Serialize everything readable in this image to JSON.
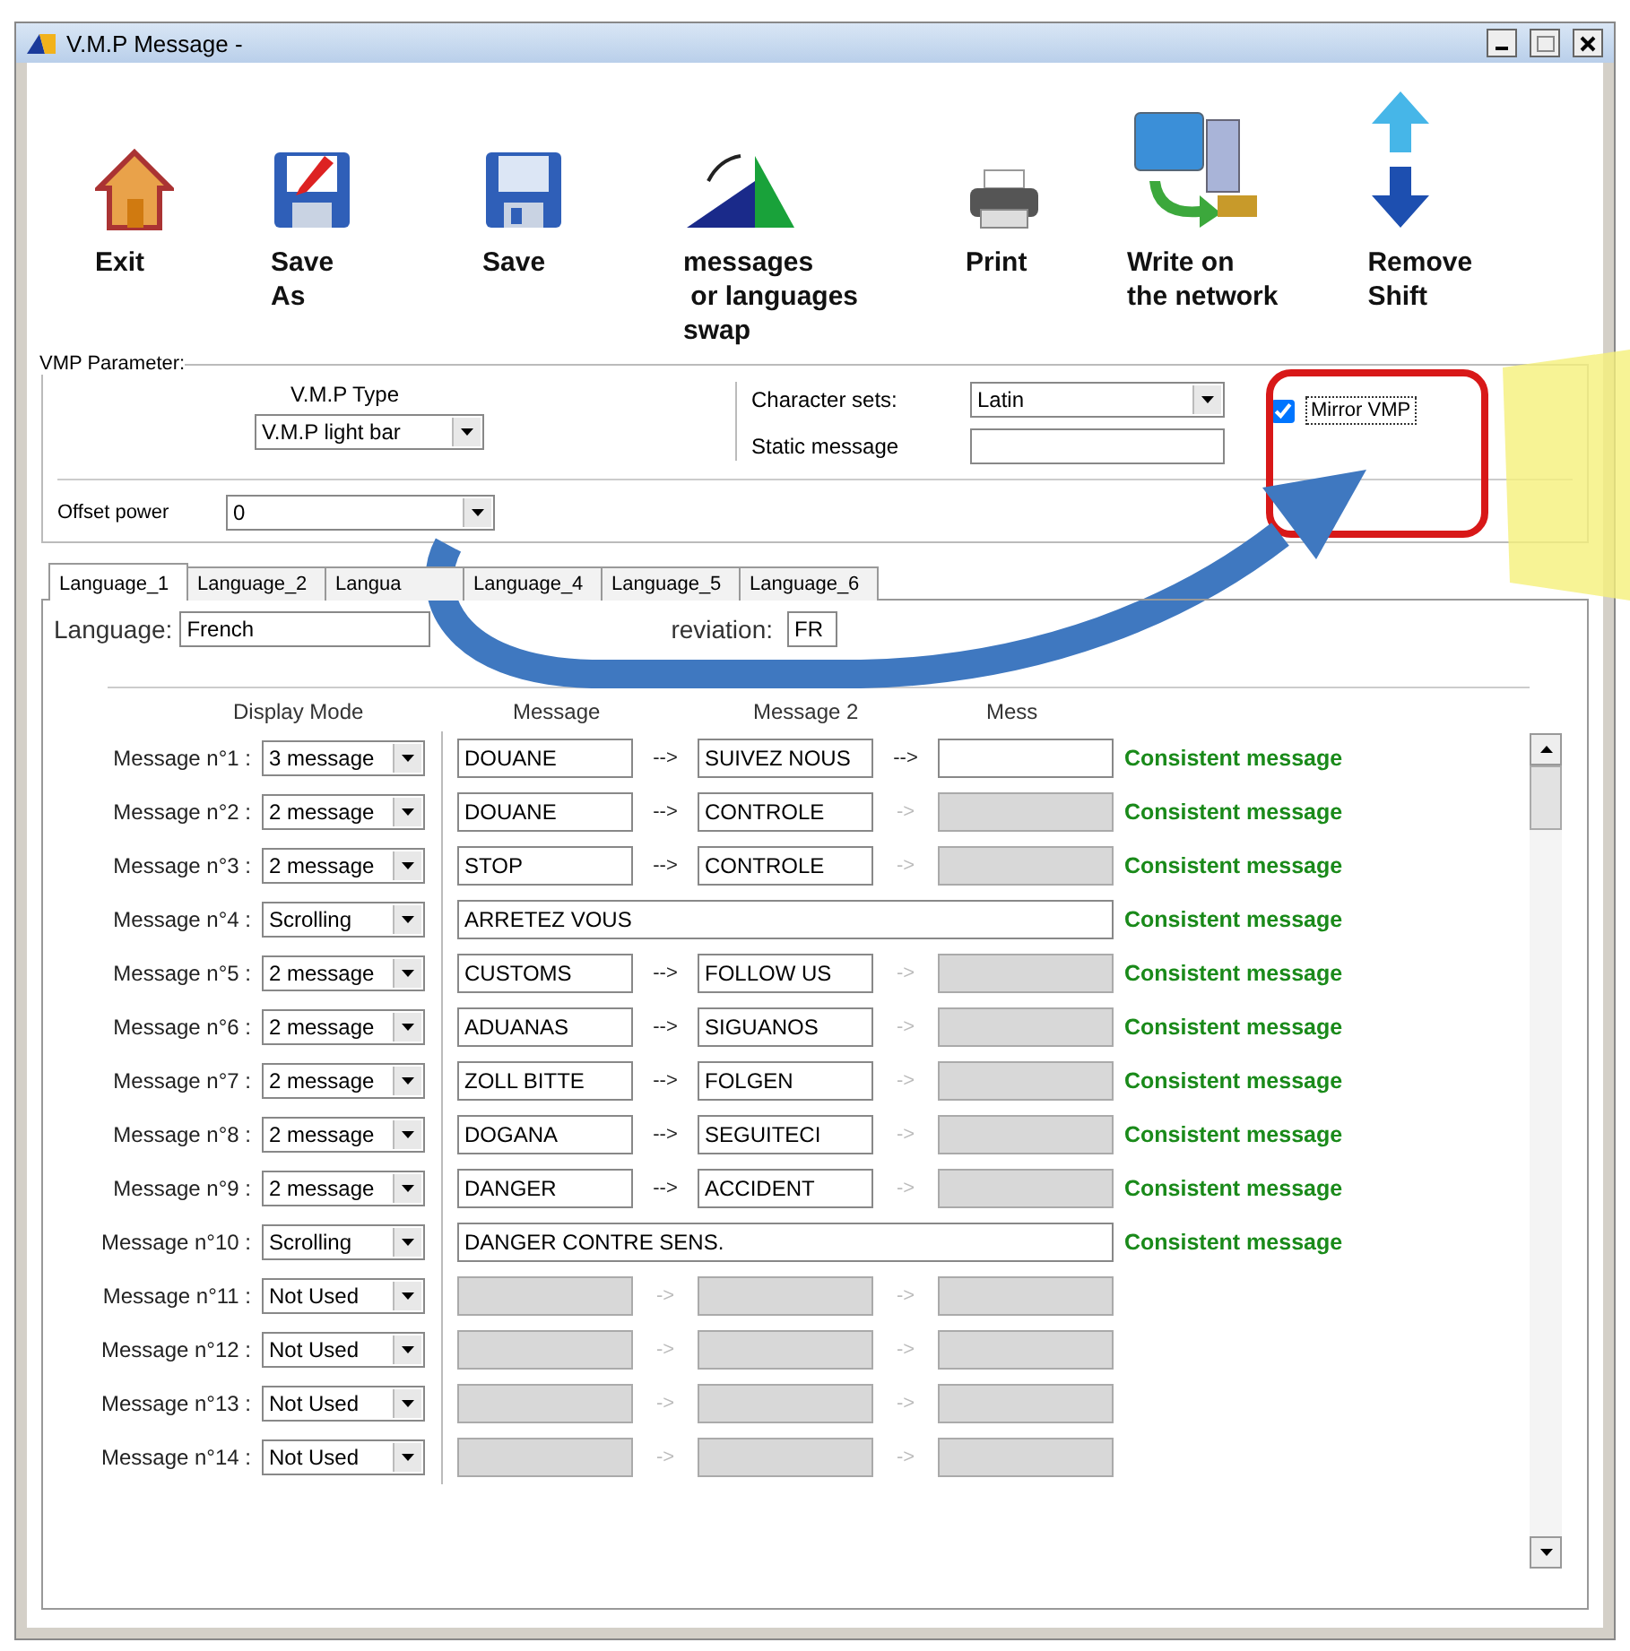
{
  "window": {
    "title": "V.M.P Message -"
  },
  "toolbar": [
    {
      "kind": "home",
      "label": "Exit"
    },
    {
      "kind": "saveas",
      "label": "Save\nAs"
    },
    {
      "kind": "save",
      "label": "Save"
    },
    {
      "kind": "swap",
      "label": "messages\n or languages\nswap"
    },
    {
      "kind": "print",
      "label": "Print"
    },
    {
      "kind": "network",
      "label": "Write on\nthe network"
    },
    {
      "kind": "shift",
      "label": "Remove\nShift"
    }
  ],
  "params": {
    "legend": "VMP Parameter:",
    "type_label": "V.M.P Type",
    "type_value": "V.M.P light bar",
    "charset_label": "Character sets:",
    "charset_value": "Latin",
    "static_label": "Static message",
    "mirror": {
      "label": "Mirror VMP",
      "checked": true
    },
    "offset_label": "Offset power",
    "offset_value": "0"
  },
  "tabs": [
    {
      "label": "Language_1",
      "selected": true
    },
    {
      "label": "Language_2",
      "selected": false
    },
    {
      "label": "Langua",
      "selected": false
    },
    {
      "label": "Language_4",
      "selected": false
    },
    {
      "label": "Language_5",
      "selected": false
    },
    {
      "label": "Language_6",
      "selected": false
    }
  ],
  "language": {
    "label": "Language:",
    "value": "French",
    "abbr_label": "reviation:",
    "abbr_value": "FR"
  },
  "headers": [
    "Display Mode",
    "Message",
    "Message 2",
    "Mess"
  ],
  "rows": [
    {
      "label": "Message n°1 :",
      "mode": "3 message",
      "kind": "split",
      "fields": [
        {
          "value": "DOUANE",
          "disabled": false
        },
        {
          "value": "SUIVEZ NOUS",
          "disabled": false
        },
        {
          "disabled": false
        }
      ],
      "arrows": [
        {
          "text": "-->",
          "disabled": false
        },
        {
          "text": "-->",
          "disabled": false
        }
      ],
      "status": "Consistent message"
    },
    {
      "label": "Message n°2 :",
      "mode": "2 message",
      "kind": "split",
      "fields": [
        {
          "value": "DOUANE",
          "disabled": false
        },
        {
          "value": "CONTROLE",
          "disabled": false
        },
        {
          "disabled": true
        }
      ],
      "arrows": [
        {
          "text": "-->",
          "disabled": false
        },
        {
          "text": "->",
          "disabled": true
        }
      ],
      "status": "Consistent message"
    },
    {
      "label": "Message n°3 :",
      "mode": "2 message",
      "kind": "split",
      "fields": [
        {
          "value": "STOP",
          "disabled": false
        },
        {
          "value": "CONTROLE",
          "disabled": false
        },
        {
          "disabled": true
        }
      ],
      "arrows": [
        {
          "text": "-->",
          "disabled": false
        },
        {
          "text": "->",
          "disabled": true
        }
      ],
      "status": "Consistent message"
    },
    {
      "label": "Message n°4 :",
      "mode": "Scrolling",
      "kind": "scrolling",
      "fields": [
        {
          "value": "ARRETEZ VOUS",
          "disabled": false
        }
      ],
      "arrows": [],
      "status": "Consistent message"
    },
    {
      "label": "Message n°5 :",
      "mode": "2 message",
      "kind": "split",
      "fields": [
        {
          "value": "CUSTOMS",
          "disabled": false
        },
        {
          "value": "FOLLOW US",
          "disabled": false
        },
        {
          "disabled": true
        }
      ],
      "arrows": [
        {
          "text": "-->",
          "disabled": false
        },
        {
          "text": "->",
          "disabled": true
        }
      ],
      "status": "Consistent message"
    },
    {
      "label": "Message n°6 :",
      "mode": "2 message",
      "kind": "split",
      "fields": [
        {
          "value": "ADUANAS",
          "disabled": false
        },
        {
          "value": "SIGUANOS",
          "disabled": false
        },
        {
          "disabled": true
        }
      ],
      "arrows": [
        {
          "text": "-->",
          "disabled": false
        },
        {
          "text": "->",
          "disabled": true
        }
      ],
      "status": "Consistent message"
    },
    {
      "label": "Message n°7 :",
      "mode": "2 message",
      "kind": "split",
      "fields": [
        {
          "value": "ZOLL BITTE",
          "disabled": false
        },
        {
          "value": "FOLGEN",
          "disabled": false
        },
        {
          "disabled": true
        }
      ],
      "arrows": [
        {
          "text": "-->",
          "disabled": false
        },
        {
          "text": "->",
          "disabled": true
        }
      ],
      "status": "Consistent message"
    },
    {
      "label": "Message n°8 :",
      "mode": "2 message",
      "kind": "split",
      "fields": [
        {
          "value": "DOGANA",
          "disabled": false
        },
        {
          "value": "SEGUITECI",
          "disabled": false
        },
        {
          "disabled": true
        }
      ],
      "arrows": [
        {
          "text": "-->",
          "disabled": false
        },
        {
          "text": "->",
          "disabled": true
        }
      ],
      "status": "Consistent message"
    },
    {
      "label": "Message n°9 :",
      "mode": "2 message",
      "kind": "split",
      "fields": [
        {
          "value": "DANGER",
          "disabled": false
        },
        {
          "value": "ACCIDENT",
          "disabled": false
        },
        {
          "disabled": true
        }
      ],
      "arrows": [
        {
          "text": "-->",
          "disabled": false
        },
        {
          "text": "->",
          "disabled": true
        }
      ],
      "status": "Consistent message"
    },
    {
      "label": "Message n°10 :",
      "mode": "Scrolling",
      "kind": "scrolling",
      "fields": [
        {
          "value": "DANGER CONTRE SENS.",
          "disabled": false
        }
      ],
      "arrows": [],
      "status": "Consistent message"
    },
    {
      "label": "Message n°11 :",
      "mode": "Not Used",
      "kind": "split",
      "fields": [
        {
          "disabled": true
        },
        {
          "disabled": true
        },
        {
          "disabled": true
        }
      ],
      "arrows": [
        {
          "text": "->",
          "disabled": true
        },
        {
          "text": "->",
          "disabled": true
        }
      ]
    },
    {
      "label": "Message n°12 :",
      "mode": "Not Used",
      "kind": "split",
      "fields": [
        {
          "disabled": true
        },
        {
          "disabled": true
        },
        {
          "disabled": true
        }
      ],
      "arrows": [
        {
          "text": "->",
          "disabled": true
        },
        {
          "text": "->",
          "disabled": true
        }
      ]
    },
    {
      "label": "Message n°13 :",
      "mode": "Not Used",
      "kind": "split",
      "fields": [
        {
          "disabled": true
        },
        {
          "disabled": true
        },
        {
          "disabled": true
        }
      ],
      "arrows": [
        {
          "text": "->",
          "disabled": true
        },
        {
          "text": "->",
          "disabled": true
        }
      ]
    },
    {
      "label": "Message n°14 :",
      "mode": "Not Used",
      "kind": "split",
      "fields": [
        {
          "disabled": true
        },
        {
          "disabled": true
        },
        {
          "disabled": true
        }
      ],
      "arrows": [
        {
          "text": "->",
          "disabled": true
        },
        {
          "text": "->",
          "disabled": true
        }
      ]
    }
  ]
}
